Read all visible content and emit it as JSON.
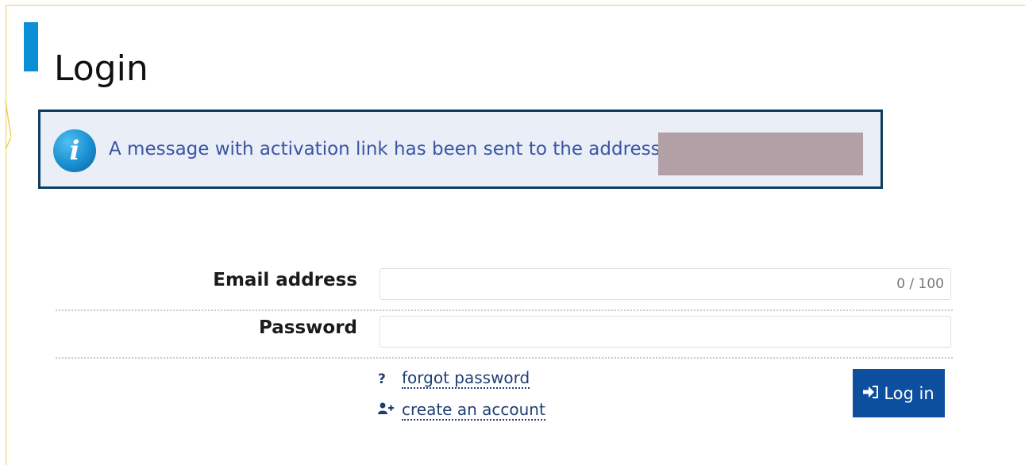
{
  "page": {
    "title": "Login"
  },
  "alert": {
    "message": "A message with activation link has been sent to the address:",
    "icon": "info-icon"
  },
  "form": {
    "email": {
      "label": "Email address",
      "value": "",
      "counter": "0 / 100"
    },
    "password": {
      "label": "Password",
      "value": ""
    }
  },
  "links": {
    "forgot": {
      "icon": "question-icon",
      "glyph": "?",
      "label": "forgot password"
    },
    "create": {
      "icon": "add-user-icon",
      "label": "create an account"
    }
  },
  "login_button": {
    "icon": "sign-in-icon",
    "label": "Log in"
  },
  "colors": {
    "accent": "#0a8fd6",
    "panel_border": "#f0cf55",
    "alert_border": "#0d3d61",
    "alert_bg": "#e9eef7",
    "button_bg": "#0c4f9e",
    "link": "#1f3f73"
  }
}
